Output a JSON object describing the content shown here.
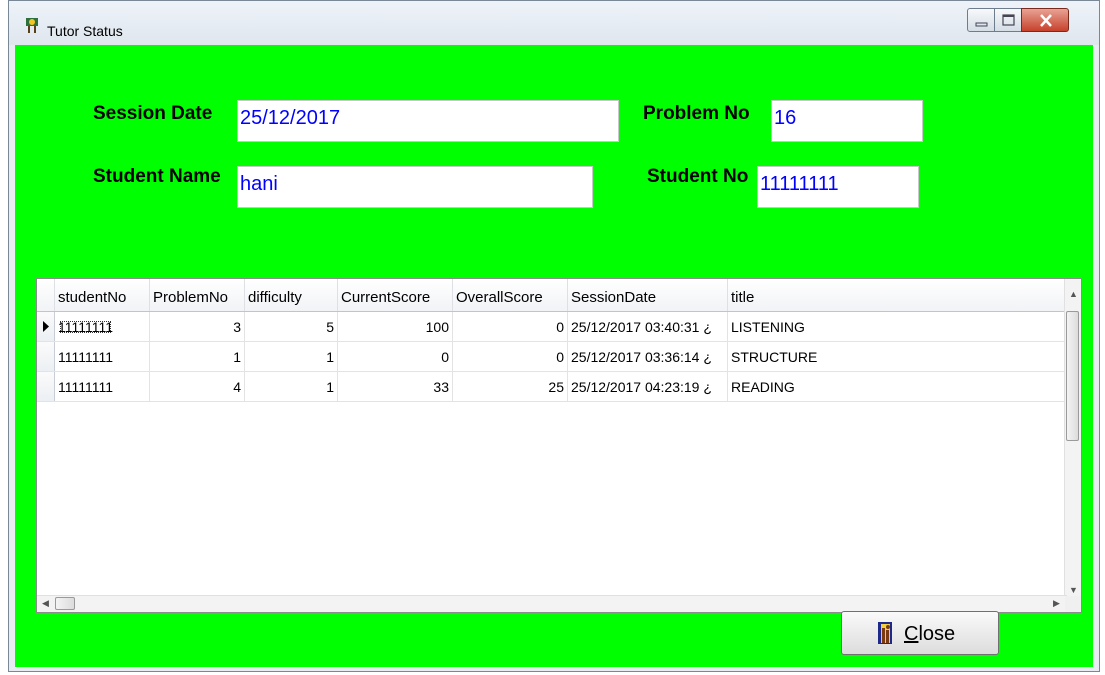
{
  "window": {
    "title": "Tutor Status"
  },
  "form": {
    "session_date_label": "Session Date",
    "session_date_value": "25/12/2017",
    "problem_no_label": "Problem No",
    "problem_no_value": "16",
    "student_name_label": "Student Name",
    "student_name_value": "hani",
    "student_no_label": "Student No",
    "student_no_value": "11111111",
    "field_text_color": "#0000ff",
    "background_color": "#00ff00"
  },
  "grid": {
    "columns": [
      "studentNo",
      "ProblemNo",
      "difficulty",
      "CurrentScore",
      "OverallScore",
      "SessionDate",
      "title"
    ],
    "rows": [
      [
        "11111111",
        "3",
        "5",
        "100",
        "0",
        "25/12/2017 03:40:31 ¿",
        "LISTENING"
      ],
      [
        "11111111",
        "1",
        "1",
        "0",
        "0",
        "25/12/2017 03:36:14 ¿",
        "STRUCTURE"
      ],
      [
        "11111111",
        "4",
        "1",
        "33",
        "25",
        "25/12/2017 04:23:19 ¿",
        "READING"
      ]
    ],
    "selected_row": 0
  },
  "buttons": {
    "close_label": "Close",
    "close_accel": "C",
    "close_rest": "lose"
  }
}
